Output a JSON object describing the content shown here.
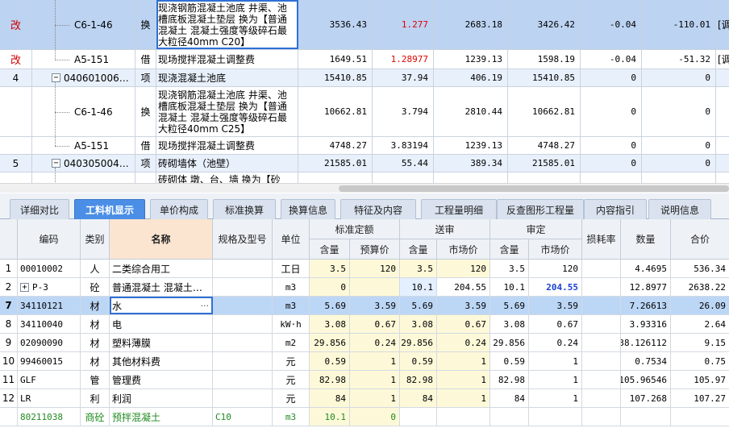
{
  "top_rows": [
    {
      "flag": "改",
      "code": "C6-1-46",
      "type": "换",
      "name": "现浇钢筋混凝土池底 井渠、池槽底板混凝土垫层  换为【普通混凝土 混凝土强度等级碎石最大粒径40mm C20】",
      "v1": "3536.43",
      "v2": "1.277",
      "v3": "2683.18",
      "v4": "3426.42",
      "v5": "-0.04",
      "v6": "-110.01",
      "v7": "[调"
    },
    {
      "flag": "改",
      "code": "A5-151",
      "type": "借",
      "name": "现场搅拌混凝土调整费",
      "v1": "1649.51",
      "v2": "1.28977",
      "v3": "1239.13",
      "v4": "1598.19",
      "v5": "-0.04",
      "v6": "-51.32",
      "v7": "[调"
    },
    {
      "flag": "4",
      "code": "040601006…",
      "type": "项",
      "name": "现浇混凝土池底",
      "v1": "15410.85",
      "v2": "37.94",
      "v3": "406.19",
      "v4": "15410.85",
      "v5": "0",
      "v6": "0",
      "v7": ""
    },
    {
      "flag": "",
      "code": "C6-1-46",
      "type": "换",
      "name": "现浇钢筋混凝土池底 井渠、池槽底板混凝土垫层  换为【普通混凝土 混凝土强度等级碎石最大粒径40mm C25】",
      "v1": "10662.81",
      "v2": "3.794",
      "v3": "2810.44",
      "v4": "10662.81",
      "v5": "0",
      "v6": "0",
      "v7": ""
    },
    {
      "flag": "",
      "code": "A5-151",
      "type": "借",
      "name": "现场搅拌混凝土调整费",
      "v1": "4748.27",
      "v2": "3.83194",
      "v3": "1239.13",
      "v4": "4748.27",
      "v5": "0",
      "v6": "0",
      "v7": ""
    },
    {
      "flag": "5",
      "code": "040305004…",
      "type": "项",
      "name": "砖砌墙体（池壁）",
      "v1": "21585.01",
      "v2": "55.44",
      "v3": "389.34",
      "v4": "21585.01",
      "v5": "0",
      "v6": "0",
      "v7": ""
    },
    {
      "flag": "",
      "code": "",
      "type": "",
      "name": "砖砌体  墩、台、墙  换为【砂",
      "v1": "",
      "v2": "",
      "v3": "",
      "v4": "",
      "v5": "",
      "v6": "",
      "v7": ""
    }
  ],
  "tabs": [
    "详细对比",
    "工料机显示",
    "单价构成",
    "标准换算",
    "换算信息",
    "特征及内容",
    "工程量明细",
    "反查图形工程量",
    "内容指引",
    "说明信息"
  ],
  "active_tab": "工料机显示",
  "bottom_headers": {
    "code": "编码",
    "type": "类别",
    "name": "名称",
    "spec": "规格及型号",
    "unit": "单位",
    "std": "标准定额",
    "send": "送审",
    "audit": "审定",
    "qty": "含量",
    "budget_price": "预算价",
    "market_price": "市场价",
    "loss": "损耗率",
    "amount": "数量",
    "total": "合价"
  },
  "bottom_rows": [
    {
      "no": "1",
      "code": "00010002",
      "type": "人",
      "name": "二类综合用工",
      "spec": "",
      "unit": "工日",
      "sq": "3.5",
      "sp": "120",
      "dq": "3.5",
      "dp": "120",
      "aq": "3.5",
      "ap": "120",
      "loss": "",
      "amount": "4.4695",
      "total": "536.34"
    },
    {
      "no": "2",
      "code": "P-3",
      "type": "砼",
      "name": "普通混凝土 混凝土…",
      "spec": "",
      "unit": "m3",
      "sq": "0",
      "sp": "",
      "dq": "10.1",
      "dp": "204.55",
      "aq": "10.1",
      "ap": "204.55",
      "loss": "",
      "amount": "12.8977",
      "total": "2638.22"
    },
    {
      "no": "7",
      "code": "34110121",
      "type": "材",
      "name": "水",
      "spec": "",
      "unit": "m3",
      "sq": "5.69",
      "sp": "3.59",
      "dq": "5.69",
      "dp": "3.59",
      "aq": "5.69",
      "ap": "3.59",
      "loss": "",
      "amount": "7.26613",
      "total": "26.09"
    },
    {
      "no": "8",
      "code": "34110040",
      "type": "材",
      "name": "电",
      "spec": "",
      "unit": "kW·h",
      "sq": "3.08",
      "sp": "0.67",
      "dq": "3.08",
      "dp": "0.67",
      "aq": "3.08",
      "ap": "0.67",
      "loss": "",
      "amount": "3.93316",
      "total": "2.64"
    },
    {
      "no": "9",
      "code": "02090090",
      "type": "材",
      "name": "塑料薄膜",
      "spec": "",
      "unit": "m2",
      "sq": "29.856",
      "sp": "0.24",
      "dq": "29.856",
      "dp": "0.24",
      "aq": "29.856",
      "ap": "0.24",
      "loss": "",
      "amount": "38.126112",
      "total": "9.15"
    },
    {
      "no": "10",
      "code": "99460015",
      "type": "材",
      "name": "其他材料费",
      "spec": "",
      "unit": "元",
      "sq": "0.59",
      "sp": "1",
      "dq": "0.59",
      "dp": "1",
      "aq": "0.59",
      "ap": "1",
      "loss": "",
      "amount": "0.7534",
      "total": "0.75"
    },
    {
      "no": "11",
      "code": "GLF",
      "type": "管",
      "name": "管理费",
      "spec": "",
      "unit": "元",
      "sq": "82.98",
      "sp": "1",
      "dq": "82.98",
      "dp": "1",
      "aq": "82.98",
      "ap": "1",
      "loss": "",
      "amount": "105.96546",
      "total": "105.97"
    },
    {
      "no": "12",
      "code": "LR",
      "type": "利",
      "name": "利润",
      "spec": "",
      "unit": "元",
      "sq": "84",
      "sp": "1",
      "dq": "84",
      "dp": "1",
      "aq": "84",
      "ap": "1",
      "loss": "",
      "amount": "107.268",
      "total": "107.27"
    },
    {
      "no": "",
      "code": "80211038",
      "type": "商砼",
      "name": "预拌混凝土",
      "spec": "C10",
      "unit": "m3",
      "sq": "10.1",
      "sp": "0",
      "dq": "",
      "dp": "",
      "aq": "",
      "ap": "",
      "loss": "",
      "amount": "",
      "total": ""
    }
  ],
  "colors": {
    "accent": "#4a8ee6",
    "selection": "#bcd6f5",
    "flag_red": "#d40000",
    "name_header": "#fbe5d0"
  }
}
